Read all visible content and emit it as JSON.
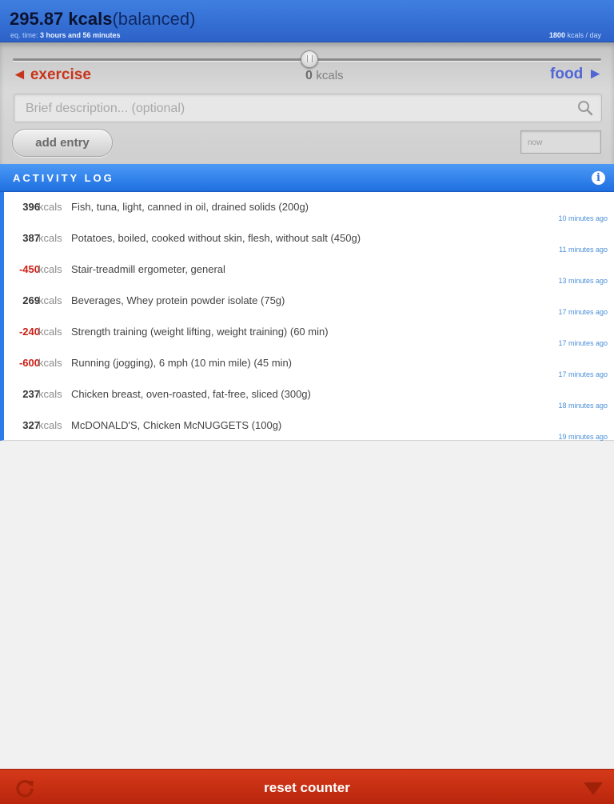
{
  "header": {
    "total_value": "295.87 kcals",
    "state": "(balanced)",
    "eq_time_label": "eq. time:",
    "eq_time_value": "3 hours and 56 minutes",
    "daily_value": "1800",
    "daily_unit": "kcals / day"
  },
  "controls": {
    "exercise_arrow": "◄",
    "exercise_label": "exercise",
    "food_label": "food",
    "food_arrow": "►",
    "slider_value": "0",
    "slider_unit": "kcals",
    "description_placeholder": "Brief description... (optional)",
    "description_value": "",
    "add_entry_label": "add entry",
    "time_placeholder": "now"
  },
  "log": {
    "title": "ACTIVITY LOG",
    "info_glyph": "i",
    "unit": "kcals",
    "entries": [
      {
        "value": "396",
        "description": "Fish, tuna, light, canned in oil, drained solids (200g)",
        "time": "10 minutes ago"
      },
      {
        "value": "387",
        "description": "Potatoes, boiled, cooked without skin, flesh, without salt (450g)",
        "time": "11 minutes ago"
      },
      {
        "value": "-450",
        "description": "Stair-treadmill ergometer, general",
        "time": "13 minutes ago"
      },
      {
        "value": "269",
        "description": "Beverages, Whey protein powder isolate (75g)",
        "time": "17 minutes ago"
      },
      {
        "value": "-240",
        "description": "Strength training (weight lifting, weight training) (60 min)",
        "time": "17 minutes ago"
      },
      {
        "value": "-600",
        "description": "Running (jogging), 6 mph (10 min mile) (45 min)",
        "time": "17 minutes ago"
      },
      {
        "value": "237",
        "description": "Chicken breast, oven-roasted, fat-free, sliced (300g)",
        "time": "18 minutes ago"
      },
      {
        "value": "327",
        "description": "McDONALD'S, Chicken McNUGGETS (100g)",
        "time": "19 minutes ago"
      }
    ]
  },
  "footer": {
    "reset_label": "reset counter"
  },
  "colors": {
    "header_blue": "#2d62c9",
    "log_blue": "#2b7bea",
    "exercise_red": "#c8341b",
    "food_blue": "#4f66d4",
    "negative_red": "#cc1f14",
    "footer_red": "#c4300f"
  },
  "icons": {
    "search": "magnifier-icon",
    "info": "info-icon",
    "refresh": "refresh-icon",
    "collapse": "down-arrow-icon"
  }
}
